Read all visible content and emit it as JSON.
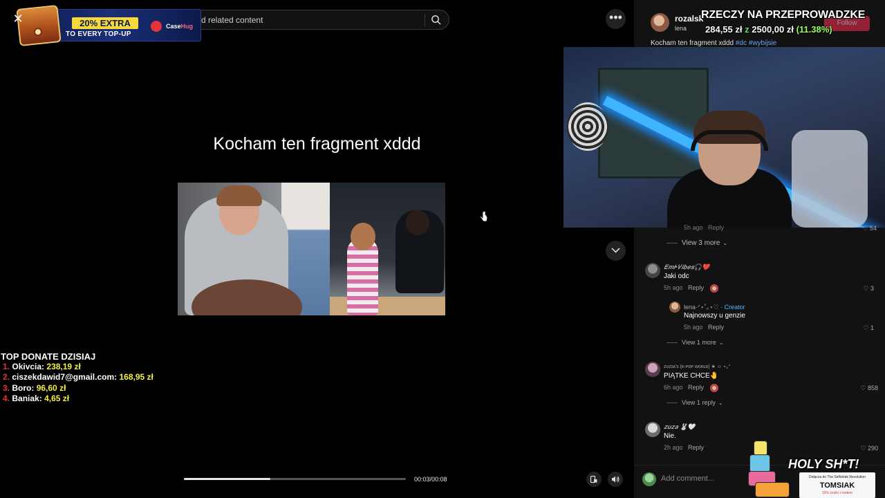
{
  "search": {
    "placeholder_visible": "d related content"
  },
  "video": {
    "caption": "Kocham ten fragment xddd",
    "time": "00:03/00:08",
    "progress_fraction": 0.39
  },
  "author": {
    "name": "rozalsk",
    "sub": "lena",
    "follow_label": "Follow"
  },
  "donation_goal": {
    "title": "RZECZY NA PRZEPROWADZKE",
    "current": "284,55 zł",
    "between": "z",
    "target": "2500,00 zł",
    "percent": "(11.38%)"
  },
  "post": {
    "text": "Kocham ten fragment xddd",
    "tags": [
      "#dc",
      "#wybijsie"
    ]
  },
  "thread": {
    "hidden_time": "5h ago",
    "hidden_reply": "Reply",
    "hidden_likes": "54",
    "view_more": "View 3 more"
  },
  "comments": [
    {
      "name": "𝑬𝒎𝒊•𝑽𝒊𝒃𝒆𝒔🎧❤️",
      "text": "Jaki odc",
      "time": "5h ago",
      "reply": "Reply",
      "likes": "3",
      "replies": [
        {
          "name": "lena·ᐟ⋆˚｡⋆♡",
          "badge": "· Creator",
          "text": "Najnowszy u genzie",
          "time": "5h ago",
          "reply": "Reply",
          "likes": "1"
        }
      ],
      "view_more": "View 1 more"
    },
    {
      "name": "ᴢᴜᴢɪᴀ's (ᴋ-ᴘᴏᴘ ᴡᴏʀʟᴅ) ★ ☺ ⋆｡°",
      "text": "PIĄTKE CHCE🤚",
      "time": "6h ago",
      "reply": "Reply",
      "likes": "858",
      "view_more": "View 1 reply"
    },
    {
      "name": "𝒛𝒖𝒛𝒂 🐰🤍",
      "text": "Nie.",
      "time": "2h ago",
      "reply": "Reply",
      "likes": "290"
    }
  ],
  "comment_bar": {
    "placeholder": "Add comment..."
  },
  "promo": {
    "extra": "20% EXTRA",
    "sub": "TO EVERY TOP-UP",
    "brand_a": "Case",
    "brand_b": "Hug"
  },
  "top_donate": {
    "title": "TOP DONATE DZISIAJ",
    "donors": [
      {
        "rank": "1.",
        "name": "Okivcia:",
        "amount": "238,19 zł"
      },
      {
        "rank": "2.",
        "name": "ciszekdawid7@gmail.com:",
        "amount": "168,95 zł"
      },
      {
        "rank": "3.",
        "name": "Boro:",
        "amount": "96,60 zł"
      },
      {
        "rank": "4.",
        "name": "Baniak:",
        "amount": "4,65 zł"
      }
    ]
  },
  "alert": {
    "title": "HOLY SH*T!",
    "line1": "Dołącza do The Selfstriak Revolution",
    "name": "TOMSIAK",
    "line2": "10% zniżki z kodem"
  },
  "colors": {
    "accent": "#fe2c55",
    "tag": "#6aa6ff",
    "creator": "#4ab8ff",
    "donation_amount": "#f5f043",
    "donation_rank": "#e33535"
  },
  "icons": {
    "search": "search-icon",
    "more": "more-icon",
    "down": "chevron-down-icon",
    "pip": "picture-in-picture-icon",
    "volume": "volume-icon",
    "close": "close-icon",
    "like": "heart-icon"
  }
}
